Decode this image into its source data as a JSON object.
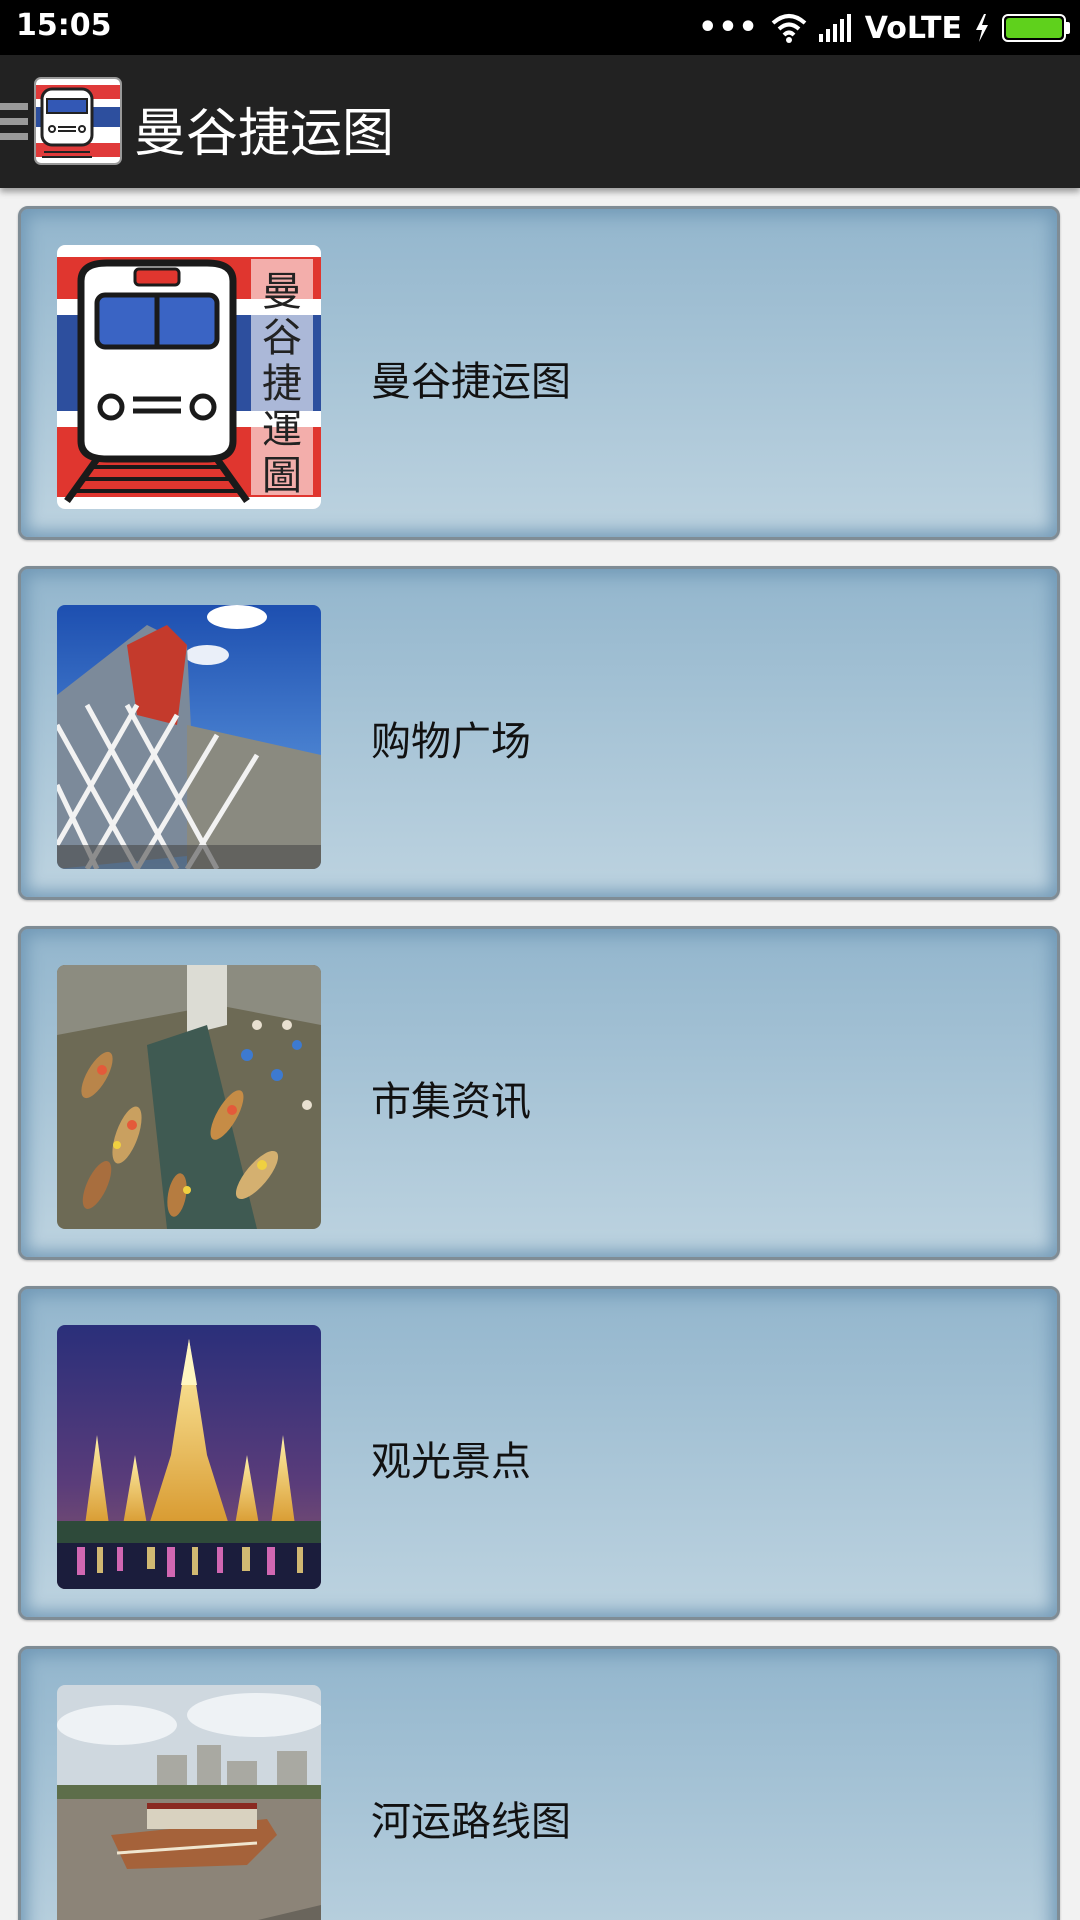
{
  "status_bar": {
    "time": "15:05",
    "dots": "•••",
    "network": "VoLTE",
    "battery_level": 1.0
  },
  "app_bar": {
    "title": "曼谷捷运图",
    "logo_text": "曼谷捷運圖"
  },
  "items": [
    {
      "label": "曼谷捷运图",
      "thumb": "train-logo-icon"
    },
    {
      "label": "购物广场",
      "thumb": "shopping-mall-image"
    },
    {
      "label": "市集资讯",
      "thumb": "floating-market-image"
    },
    {
      "label": "观光景点",
      "thumb": "temple-image"
    },
    {
      "label": "河运路线图",
      "thumb": "river-boat-image"
    }
  ],
  "colors": {
    "app_bar": "#222222",
    "card_top": "#93b6cd",
    "card_bottom": "#bdd3e0",
    "battery": "#5fd11c"
  }
}
